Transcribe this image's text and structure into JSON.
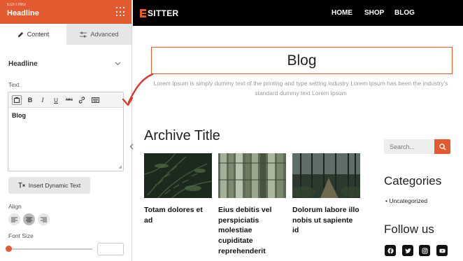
{
  "editor": {
    "editing_label": "EDITING",
    "module_title": "Headline",
    "tabs": [
      {
        "label": "Content",
        "icon": "pencil-icon",
        "active": true
      },
      {
        "label": "Advanced",
        "icon": "sliders-icon",
        "active": false
      }
    ],
    "section_title": "Headline",
    "text_label": "Text",
    "toolbar": {
      "buttons": [
        "media-icon",
        "bold-icon",
        "italic-icon",
        "underline-icon",
        "strikethrough-icon",
        "link-icon",
        "keyboard-icon"
      ],
      "bold": "B",
      "italic": "I",
      "underline": "U",
      "strike": "ABC"
    },
    "editor_value": "Blog",
    "dynamic_button_label": "Insert Dynamic Text",
    "align_label": "Align",
    "align_options": [
      "left",
      "center",
      "right"
    ],
    "align_selected": "center",
    "font_size_label": "Font Size",
    "font_size_value": "",
    "font_size_slider_fraction": 0
  },
  "site": {
    "logo": "SITTER",
    "nav": [
      "HOME",
      "SHOP",
      "BLOG"
    ],
    "headline": "Blog",
    "description": "Lorem Ipsum is simply dummy text of the printing and type setting industry Lorem Ipsum has been the industry's standard dummy text Lorem Ipsum",
    "archive_title": "Archive Title",
    "posts": [
      {
        "title": "Totam dolores et ad",
        "image": "fern-leaves"
      },
      {
        "title": "Eius debitis vel perspiciatis molestiae cupiditate reprehenderit",
        "image": "bamboo-grove"
      },
      {
        "title": "Dolorum labore illo nobis ut sapiente id",
        "image": "forest-path"
      }
    ],
    "search_placeholder": "Search...",
    "categories_title": "Categories",
    "categories": [
      "Uncategorized"
    ],
    "follow_title": "Follow us",
    "social": [
      "facebook-icon",
      "twitter-icon",
      "instagram-icon",
      "youtube-icon"
    ]
  },
  "colors": {
    "accent": "#e35a31",
    "nav_bg": "#000000",
    "tab_inactive": "#e6e6e6"
  }
}
